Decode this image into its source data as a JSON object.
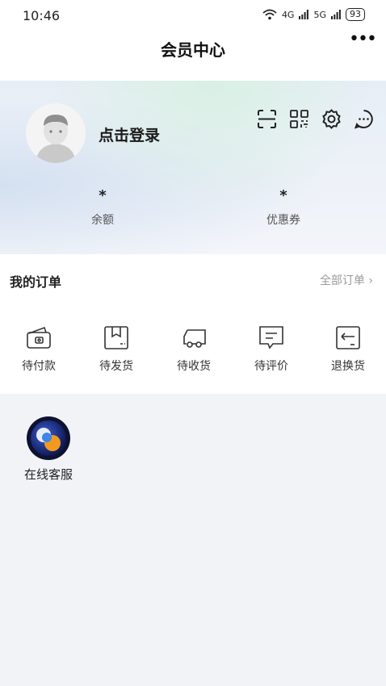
{
  "status_bar": {
    "time": "10:46",
    "signal_1": "4G",
    "signal_2": "5G",
    "battery": "93"
  },
  "header": {
    "title": "会员中心",
    "more_icon": "more-horizontal-icon"
  },
  "profile": {
    "login_text": "点击登录",
    "avatar_icon": "default-avatar-icon",
    "tools": [
      {
        "icon": "scan-icon"
      },
      {
        "icon": "qr-code-icon"
      },
      {
        "icon": "settings-icon"
      },
      {
        "icon": "message-icon"
      }
    ],
    "stats": [
      {
        "value": "*",
        "label": "余额"
      },
      {
        "value": "*",
        "label": "优惠券"
      }
    ]
  },
  "orders": {
    "title": "我的订单",
    "all_link": "全部订单 ›",
    "items": [
      {
        "label": "待付款",
        "icon": "wallet-icon"
      },
      {
        "label": "待发货",
        "icon": "package-icon"
      },
      {
        "label": "待收货",
        "icon": "truck-icon"
      },
      {
        "label": "待评价",
        "icon": "comment-icon"
      },
      {
        "label": "退换货",
        "icon": "return-icon"
      }
    ]
  },
  "services": [
    {
      "label": "在线客服",
      "icon": "customer-service-logo-icon"
    }
  ],
  "colors": {
    "accent_text": "#1a1a1a",
    "muted_text": "#9a9a9a",
    "page_bg": "#f2f3f7"
  }
}
